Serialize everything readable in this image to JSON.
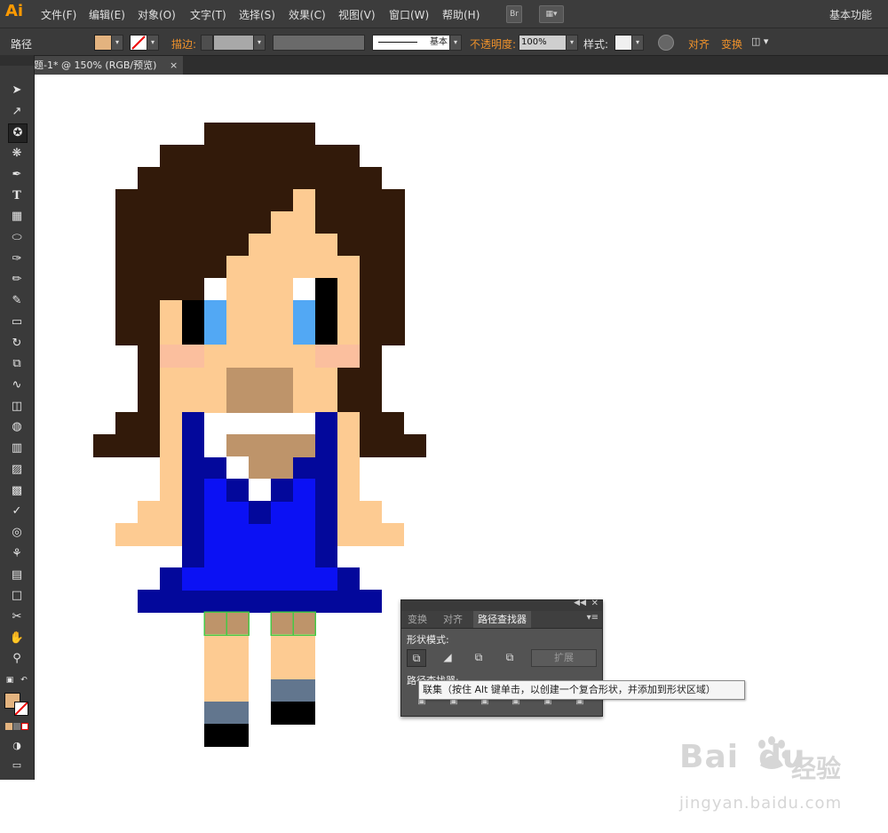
{
  "app": {
    "logo": "Ai",
    "workspace": "基本功能"
  },
  "menu": [
    "文件(F)",
    "编辑(E)",
    "对象(O)",
    "文字(T)",
    "选择(S)",
    "效果(C)",
    "视图(V)",
    "窗口(W)",
    "帮助(H)"
  ],
  "menubar_buttons": {
    "bridge": "Br"
  },
  "control": {
    "object_type": "路径",
    "fill_color": "#e3b37f",
    "stroke_label": "描边:",
    "brush_value": "基本",
    "opacity_label": "不透明度:",
    "opacity_value": "100%",
    "style_label": "样式:",
    "align_label": "对齐",
    "transform_label": "变换"
  },
  "document": {
    "tab_title": "题-1* @ 150% (RGB/预览)",
    "close": "×"
  },
  "tools": [
    "selection-tool",
    "direct-selection-tool",
    "magic-wand-tool",
    "lasso-tool",
    "pen-tool",
    "type-tool",
    "grid-tool",
    "ellipse-tool",
    "paintbrush-tool",
    "pencil-tool",
    "blob-brush-tool",
    "eraser-tool",
    "rotate-tool",
    "scale-tool",
    "warp-tool",
    "free-transform-tool",
    "shape-builder-tool",
    "perspective-grid-tool",
    "mesh-tool",
    "gradient-tool",
    "eyedropper-tool",
    "blend-tool",
    "symbol-sprayer-tool",
    "column-graph-tool",
    "artboard-tool",
    "slice-tool",
    "hand-tool",
    "zoom-tool"
  ],
  "pathfinder_panel": {
    "tabs": [
      "变换",
      "对齐",
      "路径查找器"
    ],
    "shape_modes_label": "形状模式:",
    "pathfinders_label": "路径查找器:",
    "expand_label": "扩展"
  },
  "tooltip": "联集（按住 Alt 键单击，以创建一个复合形状，并添加到形状区域）",
  "watermark": {
    "logo": "Bai",
    "logo2": "du",
    "cn": "经验",
    "url": "jingyan.baidu.com"
  }
}
